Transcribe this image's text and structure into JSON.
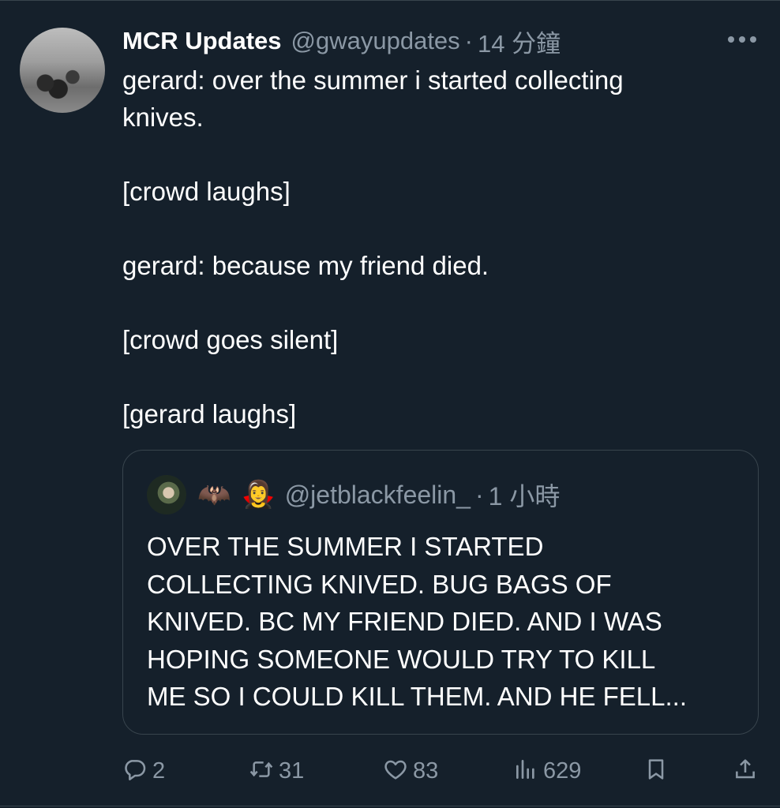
{
  "tweet": {
    "display_name": "MCR Updates",
    "handle": "@gwayupdates",
    "separator": "·",
    "time": "14 分鐘",
    "text": "gerard: over the summer i started collecting\nknives.\n\n[crowd laughs]\n\ngerard: because my friend died.\n\n[crowd goes silent]\n\n[gerard laughs]"
  },
  "quote": {
    "emojis": [
      "🦇",
      "🧛‍♀️"
    ],
    "handle": "@jetblackfeelin_",
    "separator": "·",
    "time": "1 小時",
    "text": "OVER THE SUMMER I STARTED\nCOLLECTING KNIVED. BUG BAGS OF\nKNIVED. BC MY FRIEND DIED. AND I WAS\nHOPING SOMEONE WOULD TRY TO KILL\nME SO I COULD KILL THEM. AND HE FELL..."
  },
  "actions": {
    "replies": "2",
    "retweets": "31",
    "likes": "83",
    "views": "629"
  },
  "icons": {
    "more": "more-horizontal-icon",
    "reply": "reply-icon",
    "retweet": "retweet-icon",
    "like": "heart-icon",
    "views": "views-icon",
    "bookmark": "bookmark-icon",
    "share": "share-icon"
  },
  "colors": {
    "background": "#15202b",
    "secondary_text": "#8b98a5",
    "border": "#38444d"
  }
}
